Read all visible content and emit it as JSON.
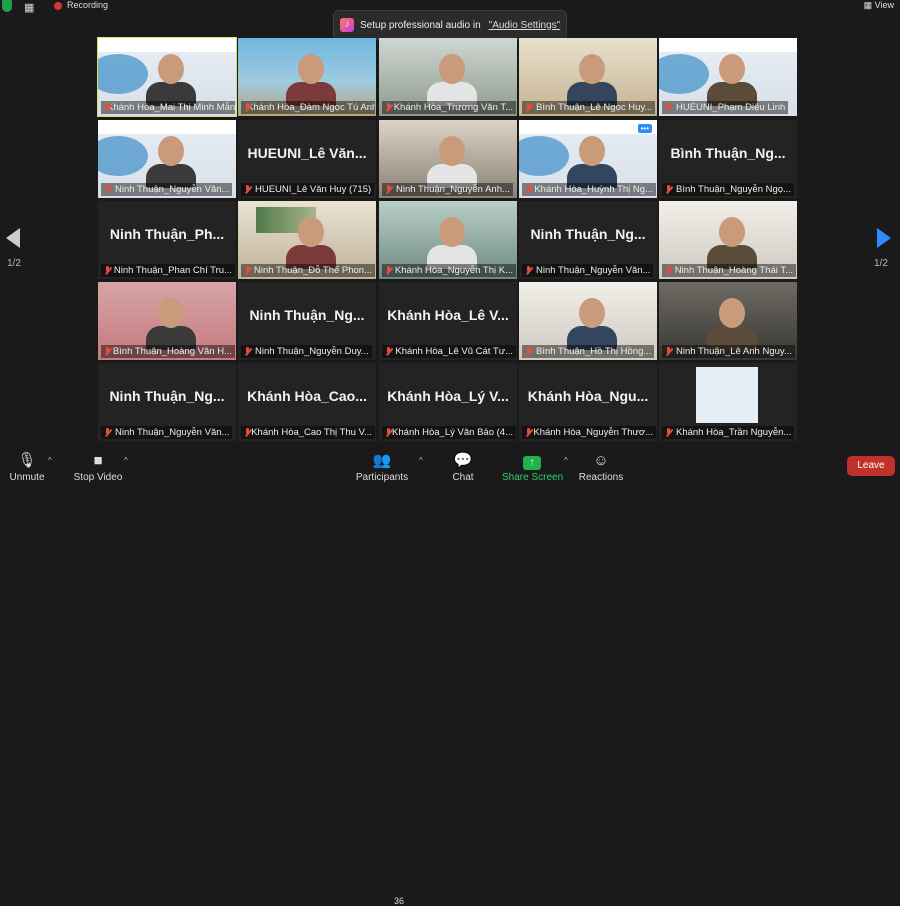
{
  "top_bar": {
    "recording_label": "Recording",
    "view_label": "View",
    "audio_banner": {
      "text": "Setup professional audio in",
      "link": "\"Audio Settings\""
    }
  },
  "pagination": {
    "left": "1/2",
    "right": "1/2"
  },
  "participants": [
    {
      "name": "Khánh Hòa_Mai Thị Minh Mẫn",
      "display": "",
      "video": "slide",
      "active": true
    },
    {
      "name": "Khánh Hòa_Đàm Ngọc Tú Anh",
      "display": "",
      "video": "beach"
    },
    {
      "name": "Khánh Hòa_Trương Văn T...",
      "display": "",
      "video": "room1"
    },
    {
      "name": "Bình Thuận_Lê Ngọc Huy...",
      "display": "",
      "video": "room2"
    },
    {
      "name": "HUEUNI_Phạm Diệu Linh",
      "display": "",
      "video": "slide"
    },
    {
      "name": "Ninh Thuận_Nguyễn Văn...",
      "display": "",
      "video": "slide"
    },
    {
      "name": "HUEUNI_Lê Văn Huy (715)",
      "display": "HUEUNI_Lê Văn...",
      "video": "none"
    },
    {
      "name": "Ninh Thuận_Nguyễn Anh...",
      "display": "",
      "video": "room3"
    },
    {
      "name": "Khánh Hòa_Huỳnh Thị Ng...",
      "display": "",
      "video": "slide",
      "menu": true
    },
    {
      "name": "Bình Thuận_Nguyễn Ngọ...",
      "display": "Bình Thuận_Ng...",
      "video": "none"
    },
    {
      "name": "Ninh Thuận_Phan Chí Tru...",
      "display": "Ninh Thuận_Ph...",
      "video": "none"
    },
    {
      "name": "Ninh Thuận_Đỗ Thế Phon...",
      "display": "",
      "video": "painting"
    },
    {
      "name": "Khánh Hòa_Nguyễn Thị K...",
      "display": "",
      "video": "room4"
    },
    {
      "name": "Ninh Thuận_Nguyễn Văn...",
      "display": "Ninh Thuận_Ng...",
      "video": "none"
    },
    {
      "name": "Ninh Thuận_Hoàng Thái T...",
      "display": "",
      "video": "wall"
    },
    {
      "name": "Bình Thuận_Hoàng Văn H...",
      "display": "",
      "video": "pink"
    },
    {
      "name": "Ninh Thuận_Nguyễn Duy...",
      "display": "Ninh Thuận_Ng...",
      "video": "none"
    },
    {
      "name": "Khánh Hòa_Lê Vũ Cát Tư...",
      "display": "Khánh Hòa_Lê V...",
      "video": "none"
    },
    {
      "name": "Bình Thuận_Hồ Thị Hồng...",
      "display": "",
      "video": "wall"
    },
    {
      "name": "Ninh Thuận_Lê Anh Nguy...",
      "display": "",
      "video": "dark"
    },
    {
      "name": "Ninh Thuận_Nguyễn Văn...",
      "display": "Ninh Thuận_Ng...",
      "video": "none"
    },
    {
      "name": "Khánh Hòa_Cao Thị Thu V...",
      "display": "Khánh Hòa_Cao...",
      "video": "none"
    },
    {
      "name": "Khánh Hòa_Lý Văn Bảo (4...",
      "display": "Khánh Hòa_Lý V...",
      "video": "none"
    },
    {
      "name": "Khánh Hòa_Nguyễn Thươ...",
      "display": "Khánh Hòa_Ngu...",
      "video": "none"
    },
    {
      "name": "Khánh Hòa_Trần Nguyễn...",
      "display": "",
      "video": "smallslide"
    }
  ],
  "toolbar": {
    "unmute": "Unmute",
    "stop_video": "Stop Video",
    "participants": "Participants",
    "participant_count": "36",
    "chat": "Chat",
    "share_screen": "Share Screen",
    "reactions": "Reactions",
    "leave": "Leave"
  },
  "colors": {
    "leave": "#c0312b",
    "share": "#23b14d",
    "active_border": "#d8e26a",
    "nav_arrow": "#2d8cff"
  }
}
